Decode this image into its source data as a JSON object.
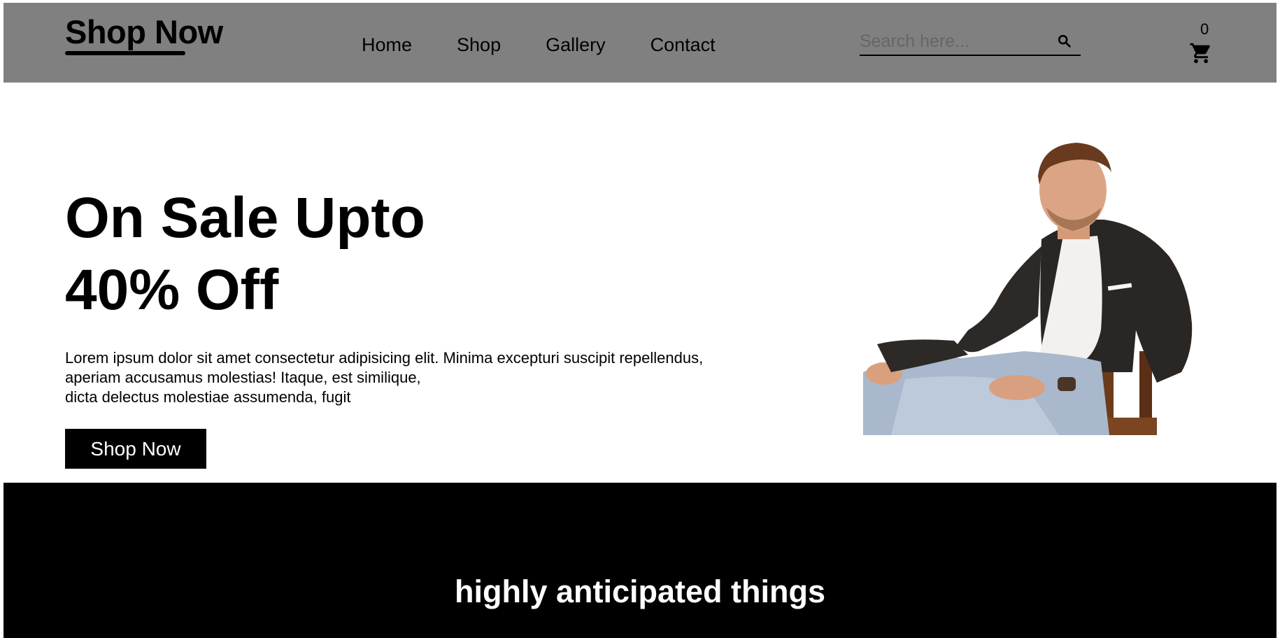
{
  "header": {
    "logo": "Shop Now",
    "nav": [
      {
        "label": "Home"
      },
      {
        "label": "Shop"
      },
      {
        "label": "Gallery"
      },
      {
        "label": "Contact"
      }
    ],
    "search": {
      "placeholder": "Search here...",
      "value": ""
    },
    "cart": {
      "count": "0"
    }
  },
  "hero": {
    "title_line1": "On Sale Upto",
    "title_line2": "40% Off",
    "description_lines": [
      "Lorem ipsum dolor sit amet consectetur adipisicing elit. Minima excepturi suscipit repellendus,",
      "aperiam accusamus molestias! Itaque, est similique,",
      "dicta delectus molestiae assumenda, fugit"
    ],
    "button_label": "Shop Now"
  },
  "section": {
    "title": "highly anticipated things"
  },
  "icons": {
    "search": "search-icon",
    "cart": "cart-icon"
  },
  "colors": {
    "header_bg": "#808080",
    "button_bg": "#000000",
    "dark_section_bg": "#000000"
  }
}
